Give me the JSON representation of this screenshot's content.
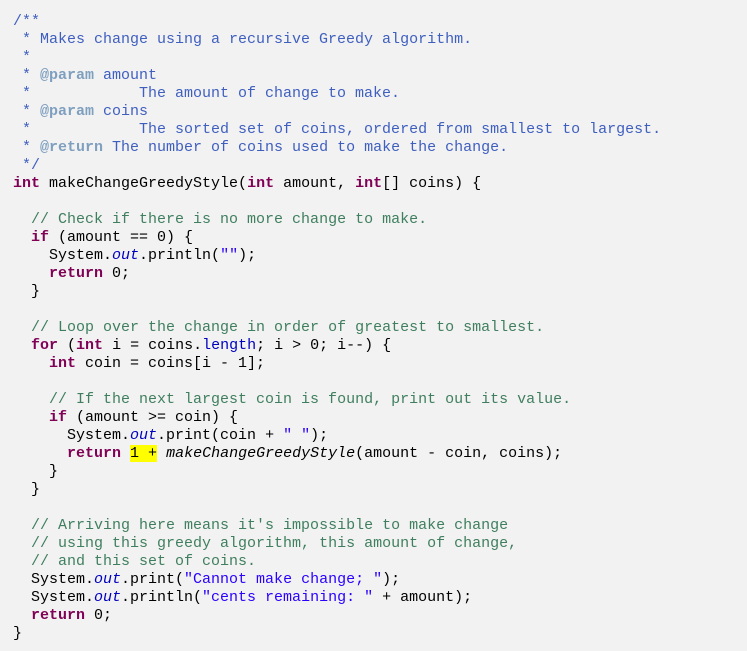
{
  "editor": {
    "language": "java",
    "colors": {
      "background": "#f2f2f2",
      "keyword": "#7f0055",
      "javadoc": "#3f5fbf",
      "javadoc_tag": "#7f9fbf",
      "comment": "#3f7f5f",
      "string": "#2a00ff",
      "field": "#0000c0",
      "highlight": "#ffff00"
    },
    "lines": [
      [
        [
          "jdoc",
          "/**"
        ]
      ],
      [
        [
          "jdoc",
          " * Makes change using a recursive Greedy algorithm."
        ]
      ],
      [
        [
          "jdoc",
          " *"
        ]
      ],
      [
        [
          "jdoc",
          " * "
        ],
        [
          "jtag",
          "@param"
        ],
        [
          "jdoc",
          " amount"
        ]
      ],
      [
        [
          "jdoc",
          " *            The amount of change to make."
        ]
      ],
      [
        [
          "jdoc",
          " * "
        ],
        [
          "jtag",
          "@param"
        ],
        [
          "jdoc",
          " coins"
        ]
      ],
      [
        [
          "jdoc",
          " *            The sorted set of coins, ordered from smallest to largest."
        ]
      ],
      [
        [
          "jdoc",
          " * "
        ],
        [
          "jtag",
          "@return"
        ],
        [
          "jdoc",
          " The number of coins used to make the change."
        ]
      ],
      [
        [
          "jdoc",
          " */"
        ]
      ],
      [
        [
          "kw",
          "int"
        ],
        [
          "plain",
          " makeChangeGreedyStyle("
        ],
        [
          "kw",
          "int"
        ],
        [
          "plain",
          " amount, "
        ],
        [
          "kw",
          "int"
        ],
        [
          "plain",
          "[] coins) {"
        ]
      ],
      [],
      [
        [
          "plain",
          "  "
        ],
        [
          "cmt",
          "// Check if there is no more change to make."
        ]
      ],
      [
        [
          "plain",
          "  "
        ],
        [
          "kw",
          "if"
        ],
        [
          "plain",
          " (amount == 0) {"
        ]
      ],
      [
        [
          "plain",
          "    System."
        ],
        [
          "static",
          "out"
        ],
        [
          "plain",
          ".println("
        ],
        [
          "str",
          "\"\""
        ],
        [
          "plain",
          ");"
        ]
      ],
      [
        [
          "plain",
          "    "
        ],
        [
          "kw",
          "return"
        ],
        [
          "plain",
          " 0;"
        ]
      ],
      [
        [
          "plain",
          "  }"
        ]
      ],
      [],
      [
        [
          "plain",
          "  "
        ],
        [
          "cmt",
          "// Loop over the change in order of greatest to smallest."
        ]
      ],
      [
        [
          "plain",
          "  "
        ],
        [
          "kw",
          "for"
        ],
        [
          "plain",
          " ("
        ],
        [
          "kw",
          "int"
        ],
        [
          "plain",
          " i = coins."
        ],
        [
          "field",
          "length"
        ],
        [
          "plain",
          "; i > 0; i--) {"
        ]
      ],
      [
        [
          "plain",
          "    "
        ],
        [
          "kw",
          "int"
        ],
        [
          "plain",
          " coin = coins[i - 1];"
        ]
      ],
      [],
      [
        [
          "plain",
          "    "
        ],
        [
          "cmt",
          "// If the next largest coin is found, print out its value."
        ]
      ],
      [
        [
          "plain",
          "    "
        ],
        [
          "kw",
          "if"
        ],
        [
          "plain",
          " (amount >= coin) {"
        ]
      ],
      [
        [
          "plain",
          "      System."
        ],
        [
          "static",
          "out"
        ],
        [
          "plain",
          ".print(coin + "
        ],
        [
          "str",
          "\" \""
        ],
        [
          "plain",
          ");"
        ]
      ],
      [
        [
          "plain",
          "      "
        ],
        [
          "kw",
          "return"
        ],
        [
          "plain",
          " "
        ],
        [
          "hl",
          "1 +"
        ],
        [
          "plain",
          " "
        ],
        [
          "smethod",
          "makeChangeGreedyStyle"
        ],
        [
          "plain",
          "(amount - coin, coins);"
        ]
      ],
      [
        [
          "plain",
          "    }"
        ]
      ],
      [
        [
          "plain",
          "  }"
        ]
      ],
      [],
      [
        [
          "plain",
          "  "
        ],
        [
          "cmt",
          "// Arriving here means it's impossible to make change"
        ]
      ],
      [
        [
          "plain",
          "  "
        ],
        [
          "cmt",
          "// using this greedy algorithm, this amount of change,"
        ]
      ],
      [
        [
          "plain",
          "  "
        ],
        [
          "cmt",
          "// and this set of coins."
        ]
      ],
      [
        [
          "plain",
          "  System."
        ],
        [
          "static",
          "out"
        ],
        [
          "plain",
          ".print("
        ],
        [
          "str",
          "\"Cannot make change; \""
        ],
        [
          "plain",
          ");"
        ]
      ],
      [
        [
          "plain",
          "  System."
        ],
        [
          "static",
          "out"
        ],
        [
          "plain",
          ".println("
        ],
        [
          "str",
          "\"cents remaining: \""
        ],
        [
          "plain",
          " + amount);"
        ]
      ],
      [
        [
          "plain",
          "  "
        ],
        [
          "kw",
          "return"
        ],
        [
          "plain",
          " 0;"
        ]
      ],
      [
        [
          "plain",
          "}"
        ]
      ]
    ]
  }
}
